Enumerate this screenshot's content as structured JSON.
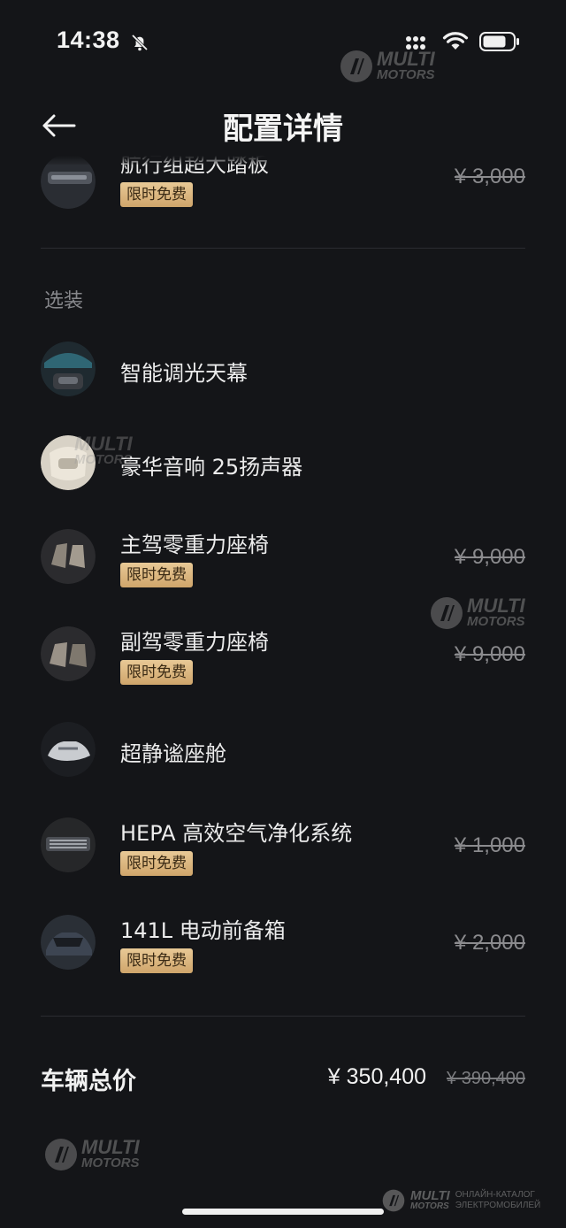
{
  "status_bar": {
    "time": "14:38"
  },
  "header": {
    "title": "配置详情"
  },
  "top_item": {
    "name": "航行组超大踏板",
    "badge": "限时免费",
    "orig_price": "¥ 3,000"
  },
  "optional_section": {
    "label": "选装",
    "items": [
      {
        "name": "智能调光天幕",
        "badge": "",
        "orig_price": ""
      },
      {
        "name": "豪华音响 25扬声器",
        "badge": "",
        "orig_price": ""
      },
      {
        "name": "主驾零重力座椅",
        "badge": "限时免费",
        "orig_price": "¥ 9,000"
      },
      {
        "name": "副驾零重力座椅",
        "badge": "限时免费",
        "orig_price": "¥ 9,000"
      },
      {
        "name": "超静谧座舱",
        "badge": "",
        "orig_price": ""
      },
      {
        "name": "HEPA 高效空气净化系统",
        "badge": "限时免费",
        "orig_price": "¥ 1,000"
      },
      {
        "name": "141L 电动前备箱",
        "badge": "限时免费",
        "orig_price": "¥ 2,000"
      }
    ]
  },
  "total": {
    "label": "车辆总价",
    "price": "¥ 350,400",
    "orig_price": "¥ 390,400"
  },
  "watermark": {
    "brand_line1": "MULTI",
    "brand_line2": "MOTORS",
    "footer_line1": "ОНЛАЙН-КАТАЛОГ",
    "footer_line2": "ЭЛЕКТРОМОБИЛЕЙ"
  },
  "icons": {
    "back": "back-arrow-icon",
    "bell": "bell-slash-icon",
    "signal": "signal-icon",
    "wifi": "wifi-icon",
    "battery": "battery-icon"
  },
  "colors": {
    "background": "#141518",
    "badge_gold": "#dcb87f",
    "text": "#ececec",
    "muted": "#8b8b8e"
  }
}
